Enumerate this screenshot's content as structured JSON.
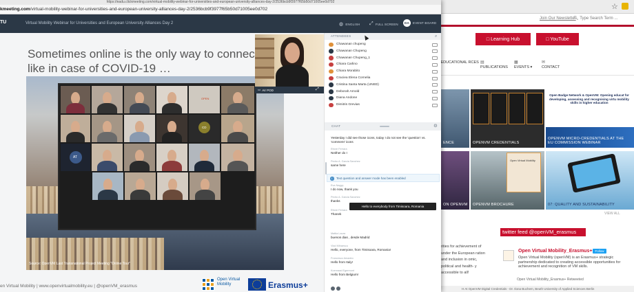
{
  "browser": {
    "url_top": "https://eadu.clickmeeting.com/virtual-mobility-webinar-for-universities-and-european-university-alliances-day-2/2536bcb9f3977f65b50d71005ee0d702",
    "url_domain": "kmeeting.com",
    "url_path": "/virtual-mobility-webinar-for-universities-and-european-university-alliances-day-2/2536bcb9f3977f65b50d71005ee0d702"
  },
  "app": {
    "logo": "TU",
    "title": "Virtual Mobility Webinar for Universities and European University Alliances Day 2",
    "language": "ENGLISH",
    "fullscreen": "FULL SCREEN",
    "user_initials": "DA",
    "user_label": "EVENT BOARD"
  },
  "slide": {
    "title": "Sometimes online is the only way to connect like in case of COVID-19 …",
    "caption": "Source: OpenVM Last Transnational Project Meeting \"Online Tour\"",
    "footer": "en Virtual Mobility | www.openvirtualmobility.eu | @openVM_erasmus",
    "ov_logo": "Open Virtual Mobility",
    "erasmus": "Erasmus+",
    "zoom_tags": [
      "OPEN",
      "AT",
      "CD"
    ]
  },
  "presenter": {
    "name": "AV POD"
  },
  "attendees": {
    "header": "ATTENDEES",
    "items": [
      {
        "name": "Chawanan chupeng",
        "color": "#e0913a"
      },
      {
        "name": "Chawanan Chupeng",
        "color": "#2b3846"
      },
      {
        "name": "Chawanan Chupeng_1",
        "color": "#c74040"
      },
      {
        "name": "Chiara Carlino",
        "color": "#c74040"
      },
      {
        "name": "Chiara Morabito",
        "color": "#e0913a"
      },
      {
        "name": "Craciea Elena Cornelia",
        "color": "#c74040"
      },
      {
        "name": "Cristina Santa Marta (UNED)",
        "color": "#2b3846"
      },
      {
        "name": "Deborah Arnold",
        "color": "#2b3846"
      },
      {
        "name": "Diana Andone",
        "color": "#2b3846"
      },
      {
        "name": "Dimitris Grevias",
        "color": "#c74040"
      }
    ]
  },
  "chat": {
    "header": "CHAT",
    "system_note": "Text question and answer mode has been enabled",
    "tooltip": "Hello to everybody from Timisoara, Romania",
    "messages": [
      {
        "author": "",
        "text": "Yesterday I did see those icons, today I do not see the 'question' vs. 'comment' icons"
      },
      {
        "author": "Ettore Ferrara",
        "text": "Neither do I"
      },
      {
        "author": "Pedro A. Garcia Sanchez",
        "text": "same here"
      },
      {
        "author": "Eva Nagyy",
        "text": "I do now, thank you"
      },
      {
        "author": "Pedro A. Garcia Sanchez",
        "text": "thanks"
      },
      {
        "author": "Ettore Ferrara",
        "text": "Thanek"
      },
      {
        "author": "Mattia Laura",
        "text": "buenos dias , desde Madrid"
      },
      {
        "author": "Vlad Mihaescu",
        "text": "Hello, everyone, from Timisoara, Romania!"
      },
      {
        "author": "Francesco Amadeo",
        "text": "Hello from Italy!"
      },
      {
        "author": "Koenraad Egermont",
        "text": "Hello from Belgium!"
      }
    ]
  },
  "bgsite": {
    "newsletter": "Join Our Newsletter",
    "search": "Type Search Term ...",
    "learning_hub": "□ Learning Hub",
    "youtube": "□ YouTube",
    "nav": [
      {
        "label": "N EDUCATIONAL RCES",
        "icon": ""
      },
      {
        "label": "PUBLICATIONS",
        "icon": "▤"
      },
      {
        "label": "EVENTS ▾",
        "icon": "▦"
      },
      {
        "label": "CONTACT",
        "icon": "✉"
      }
    ],
    "tiles": [
      {
        "caption": "ENCE"
      },
      {
        "caption": "OPENVM CREDENTIALS"
      },
      {
        "caption": "Open Badge Network & OpenVM: Opening educat for developing, assessing and recognising virtu mobility skills in higher education"
      },
      {
        "caption": "OPENVM MICRO-CREDENTIALS AT THE EU COMMISSION WEBINAR"
      },
      {
        "caption": "ON OPENVM"
      },
      {
        "caption": "OPENVM BROCHURE"
      },
      {
        "caption": "Open Virtual Mobility"
      },
      {
        "caption": "07: QUALITY AND SUSTAINABILITY"
      }
    ],
    "view_all": "VIEW ALL",
    "twitter_feed": "twitter feed @openVM_erasmus",
    "twitter_side": "rities for achievement of under the European ration and inclusion in omic, political and health- y accessible to all!",
    "tweet_name": "Open Virtual Mobility_Erasmus+",
    "follow": "Follow",
    "tweet_body": "Open Virtual Mobility (openVM) is an Erasmus+ strategic partnership dedicated to creating accessible opportunities for achievement and recognition of VM skills.",
    "retweet": "Open Virtual Mobility_Erasmus+ Retweeted",
    "bottom": "H  At OpenVM Digital Credentials - Dr. Ilona Buchem, Beuth University of Applied Sciences Berlin"
  }
}
